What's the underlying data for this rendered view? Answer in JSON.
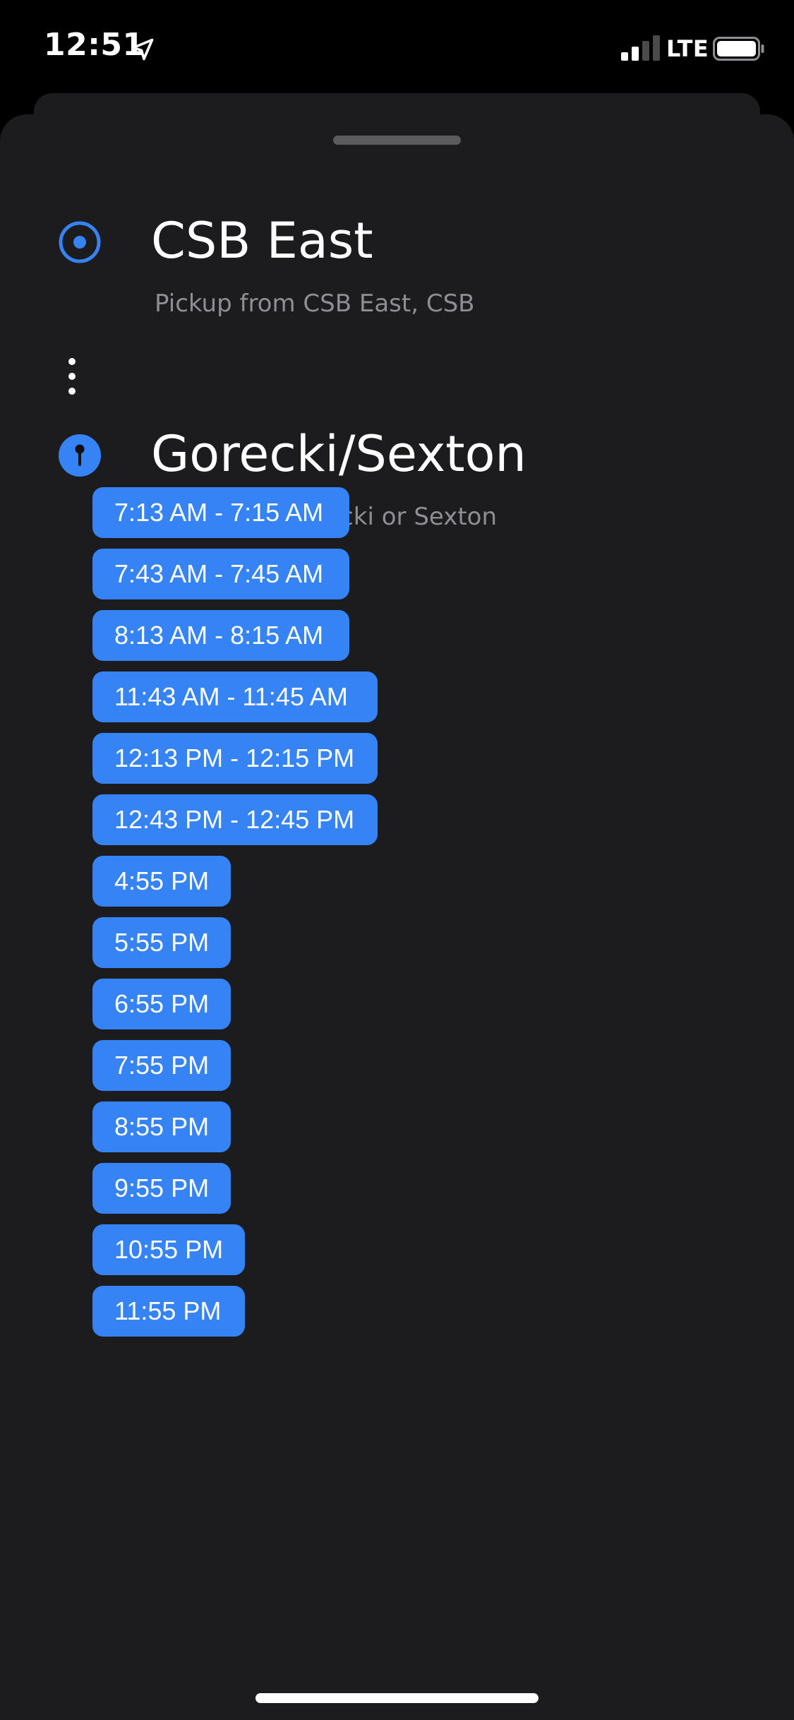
{
  "status_bar": {
    "time": "12:51",
    "network": "LTE",
    "location_icon": "location-arrow-icon",
    "signal_icon": "cellular-signal-icon",
    "battery_icon": "battery-icon"
  },
  "route": {
    "origin": {
      "icon": "origin-target-icon",
      "title": "CSB East",
      "subtitle": "Pickup from CSB East, CSB"
    },
    "connector_icon": "vertical-dots-icon",
    "destination": {
      "icon": "destination-pin-icon",
      "title": "Gorecki/Sexton",
      "subtitle": "Dropoff at Gorecki or Sexton"
    }
  },
  "times": [
    "7:13 AM - 7:15 AM",
    "7:43 AM - 7:45 AM",
    "8:13 AM - 8:15 AM",
    "11:43 AM - 11:45 AM",
    "12:13 PM - 12:15 PM",
    "12:43 PM - 12:45 PM",
    "4:55 PM",
    "5:55 PM",
    "6:55 PM",
    "7:55 PM",
    "8:55 PM",
    "9:55 PM",
    "10:55 PM",
    "11:55 PM"
  ],
  "colors": {
    "accent": "#3683f5",
    "sheet_background": "#1c1c1e",
    "subtitle": "#8e8e93"
  }
}
